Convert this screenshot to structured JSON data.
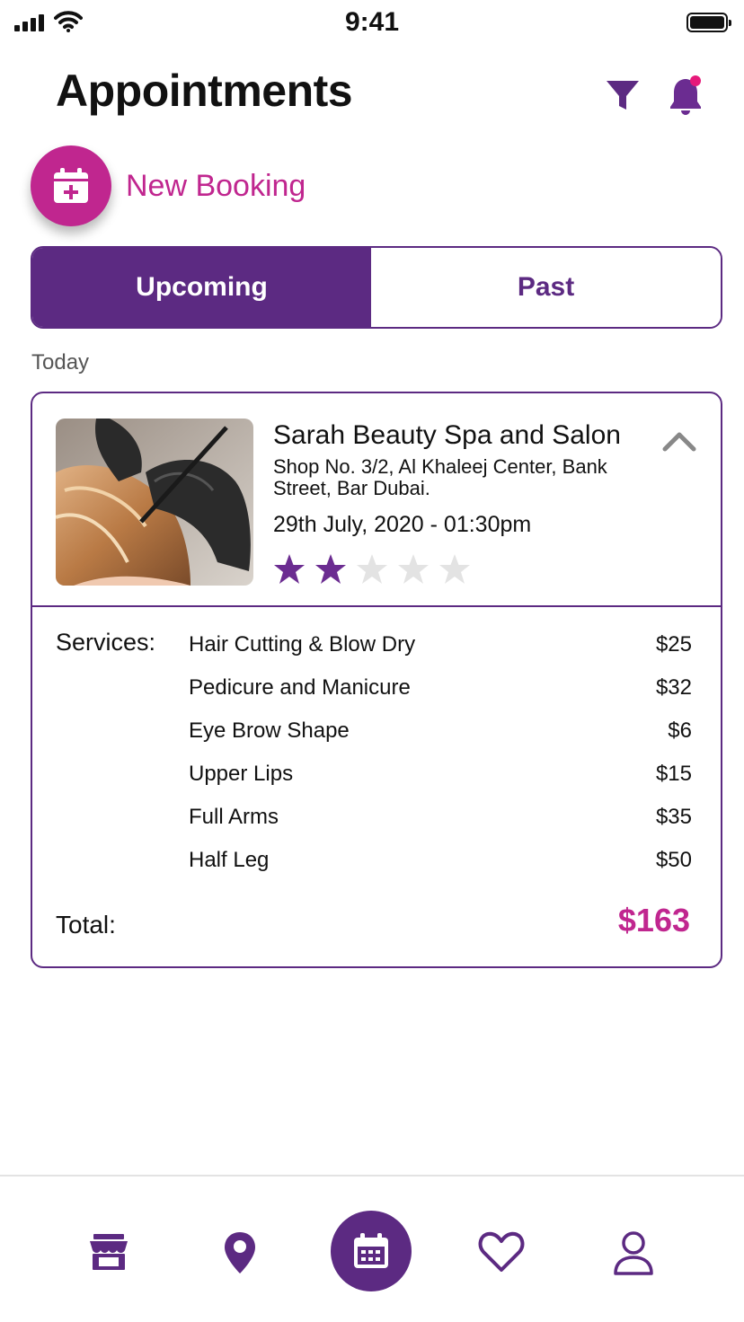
{
  "status_bar": {
    "time": "9:41"
  },
  "header": {
    "title": "Appointments"
  },
  "new_booking": {
    "label": "New Booking"
  },
  "tabs": [
    {
      "label": "Upcoming",
      "active": true
    },
    {
      "label": "Past",
      "active": false
    }
  ],
  "section": {
    "label": "Today"
  },
  "appointment": {
    "salon_name": "Sarah Beauty Spa and Salon",
    "address": "Shop No. 3/2, Al Khaleej Center, Bank Street, Bar Dubai.",
    "datetime": "29th July, 2020  -  01:30pm",
    "rating": {
      "value": 2,
      "max": 5
    },
    "services_label": "Services:",
    "services": [
      {
        "name": "Hair Cutting & Blow Dry",
        "price": "$25"
      },
      {
        "name": "Pedicure and Manicure",
        "price": "$32"
      },
      {
        "name": "Eye Brow Shape",
        "price": "$6"
      },
      {
        "name": "Upper Lips",
        "price": "$15"
      },
      {
        "name": "Full Arms",
        "price": "$35"
      },
      {
        "name": "Half Leg",
        "price": "$50"
      }
    ],
    "total_label": "Total:",
    "total_value": "$163"
  },
  "bottom_nav": {
    "items": [
      "store-icon",
      "location-pin-icon",
      "calendar-icon",
      "heart-icon",
      "user-icon"
    ],
    "active": "calendar-icon"
  },
  "colors": {
    "primary": "#5c2a82",
    "accent": "#c0268f",
    "star_on": "#6b2c91",
    "star_off": "#e3e3e3"
  }
}
